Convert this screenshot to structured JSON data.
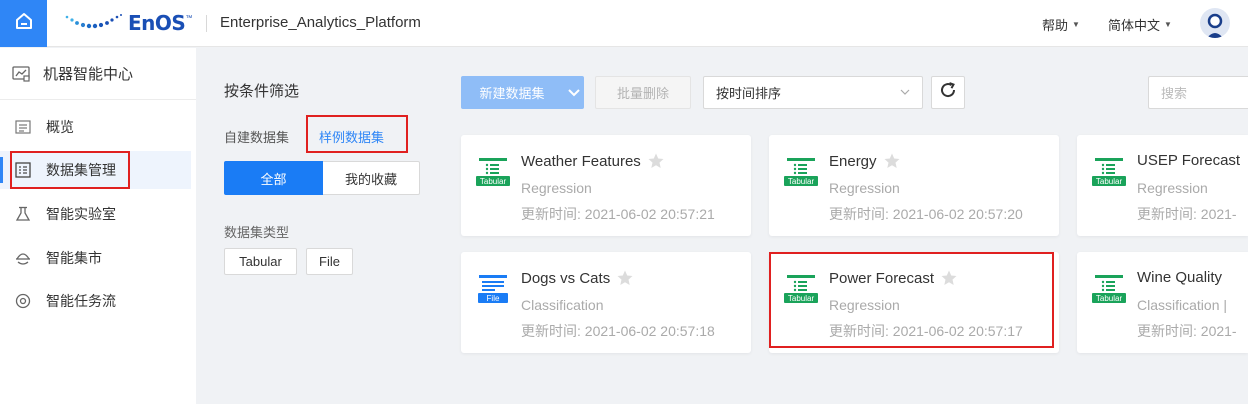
{
  "app": {
    "brand": "EnOS",
    "brand_tm": "™",
    "platform_name": "Enterprise_Analytics_Platform",
    "help_label": "帮助",
    "language_label": "简体中文"
  },
  "sidebar": {
    "header": "机器智能中心",
    "items": [
      {
        "label": "概览",
        "icon": "overview-icon"
      },
      {
        "label": "数据集管理",
        "icon": "dataset-icon",
        "active": true
      },
      {
        "label": "智能实验室",
        "icon": "lab-flask-icon"
      },
      {
        "label": "智能集市",
        "icon": "market-icon"
      },
      {
        "label": "智能任务流",
        "icon": "workflow-icon"
      }
    ]
  },
  "filters": {
    "title": "按条件筛选",
    "tab_custom": "自建数据集",
    "tab_sample": "样例数据集",
    "seg_all": "全部",
    "seg_favorites": "我的收藏",
    "type_title": "数据集类型",
    "type_tags": [
      "Tabular",
      "File"
    ]
  },
  "toolbar": {
    "new_button": "新建数据集",
    "delete_button": "批量删除",
    "sort_value": "按时间排序",
    "search_placeholder": "搜索"
  },
  "cards": [
    {
      "title": "Weather Features",
      "type": "Regression",
      "time": "更新时间: 2021-06-02 20:57:21",
      "badge": "Tabular"
    },
    {
      "title": "Energy",
      "type": "Regression",
      "time": "更新时间: 2021-06-02 20:57:20",
      "badge": "Tabular"
    },
    {
      "title": "USEP Forecast",
      "type": "Regression",
      "time": "更新时间: 2021-",
      "badge": "Tabular"
    },
    {
      "title": "Dogs vs Cats",
      "type": "Classification",
      "time": "更新时间: 2021-06-02 20:57:18",
      "badge": "File"
    },
    {
      "title": "Power Forecast",
      "type": "Regression",
      "time": "更新时间: 2021-06-02 20:57:17",
      "badge": "Tabular"
    },
    {
      "title": "Wine Quality",
      "type": "Classification |",
      "time": "更新时间: 2021-",
      "badge": "Tabular"
    }
  ],
  "colors": {
    "accent": "#2f86f6",
    "tabular_green": "#1aa35a",
    "file_blue": "#1a7cf5",
    "highlight_red": "#e02020"
  }
}
